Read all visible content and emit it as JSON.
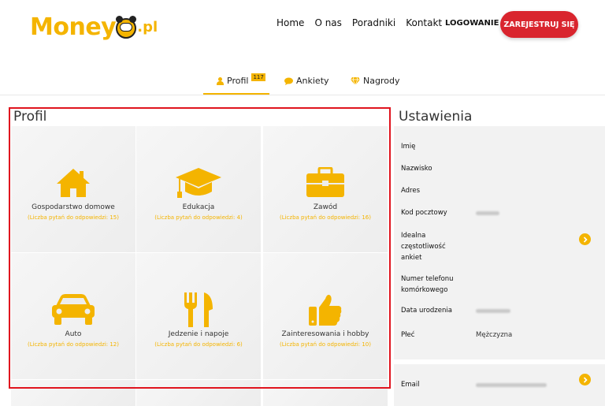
{
  "header": {
    "logo": {
      "text_pre": "Money",
      "text_suffix": ".pl"
    },
    "nav": [
      "Home",
      "O nas",
      "Poradniki",
      "Kontakt"
    ],
    "login_label": "LOGOWANIE",
    "register_label": "ZAREJESTRUJ SIĘ"
  },
  "tabs": [
    {
      "label": "Profil",
      "badge": "117",
      "icon": "person-icon",
      "active": true
    },
    {
      "label": "Ankiety",
      "icon": "chat-bubble-icon",
      "active": false
    },
    {
      "label": "Nagrody",
      "icon": "diamond-icon",
      "active": false
    }
  ],
  "profile": {
    "title": "Profil",
    "tiles": [
      {
        "name": "Gospodarstwo domowe",
        "sub": "(Liczba pytań do odpowiedzi: 15)",
        "icon": "house-icon"
      },
      {
        "name": "Edukacja",
        "sub": "(Liczba pytań do odpowiedzi: 4)",
        "icon": "graduation-cap-icon"
      },
      {
        "name": "Zawód",
        "sub": "(Liczba pytań do odpowiedzi: 16)",
        "icon": "briefcase-icon"
      },
      {
        "name": "Auto",
        "sub": "(Liczba pytań do odpowiedzi: 12)",
        "icon": "car-icon"
      },
      {
        "name": "Jedzenie i napoje",
        "sub": "(Liczba pytań do odpowiedzi: 6)",
        "icon": "fork-knife-icon"
      },
      {
        "name": "Zainteresowania i hobby",
        "sub": "(Liczba pytań do odpowiedzi: 10)",
        "icon": "thumbs-up-icon"
      }
    ]
  },
  "settings": {
    "title": "Ustawienia",
    "rows": [
      {
        "label": "Imię"
      },
      {
        "label": "Nazwisko"
      },
      {
        "label": "Adres"
      },
      {
        "label": "Kod pocztowy"
      },
      {
        "label": "Idealna\nczęstotliwość\nankiet"
      },
      {
        "label": "Numer telefonu\nkomórkowego"
      },
      {
        "label": "Data urodzenia"
      },
      {
        "label": "Płeć",
        "value": "Mężczyzna"
      },
      {
        "label": "Email"
      }
    ]
  },
  "colors": {
    "accent": "#f4b400",
    "register": "#d9252e",
    "highlight_outline": "#e0141e"
  }
}
